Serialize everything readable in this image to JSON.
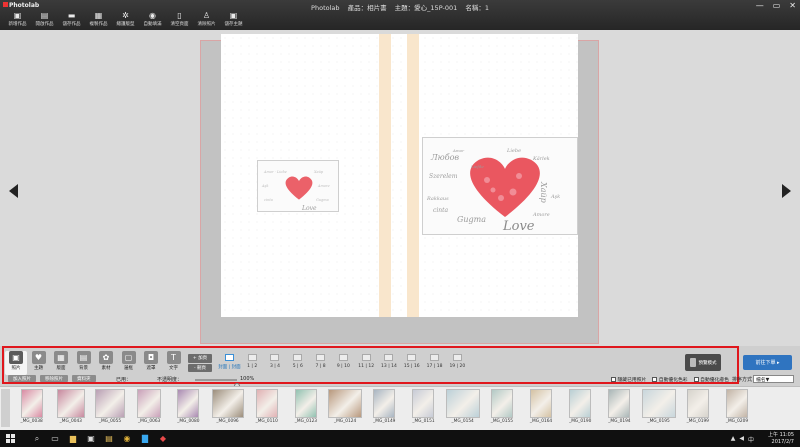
{
  "app": {
    "logo": "Photolab",
    "title": "Photolab",
    "product_label": "產品：相片書",
    "theme_label": "主題：愛心_15P-001",
    "name_label": "名稱：1"
  },
  "toolbar": {
    "items": [
      {
        "label": "新增作品",
        "icon": "new-file-icon"
      },
      {
        "label": "開啟作品",
        "icon": "open-folder-icon"
      },
      {
        "label": "儲存作品",
        "icon": "save-icon"
      },
      {
        "label": "複製作品",
        "icon": "copy-icon"
      },
      {
        "label": "總護版型",
        "icon": "sparkle-icon"
      },
      {
        "label": "自動填滿",
        "icon": "eye-icon"
      },
      {
        "label": "清空頁面",
        "icon": "clear-page-icon"
      },
      {
        "label": "清除照片",
        "icon": "clear-photo-icon"
      },
      {
        "label": "儲存主題",
        "icon": "save-theme-icon"
      }
    ]
  },
  "panel": {
    "tabs": [
      {
        "label": "照片",
        "icon": "photo-icon",
        "glyph": "▣",
        "active": true
      },
      {
        "label": "主題",
        "icon": "theme-icon",
        "glyph": "♥",
        "active": false
      },
      {
        "label": "版面",
        "icon": "layout-icon",
        "glyph": "▦",
        "active": false
      },
      {
        "label": "背景",
        "icon": "background-icon",
        "glyph": "▤",
        "active": false
      },
      {
        "label": "素材",
        "icon": "sticker-icon",
        "glyph": "✿",
        "active": false
      },
      {
        "label": "邊框",
        "icon": "frame-icon",
        "glyph": "▢",
        "active": false
      },
      {
        "label": "遮罩",
        "icon": "mask-icon",
        "glyph": "◘",
        "active": false
      },
      {
        "label": "文字",
        "icon": "text-icon",
        "glyph": "T",
        "active": false
      }
    ],
    "add_buttons": [
      "+ 加頁",
      "- 刪頁"
    ],
    "spreads": [
      "封面 | 封面",
      "1 | 2",
      "3 | 4",
      "5 | 6",
      "7 | 8",
      "9 | 10",
      "11 | 12",
      "13 | 14",
      "15 | 16",
      "17 | 18",
      "19 | 20"
    ],
    "active_spread": 0,
    "preview_label": "預覽模式",
    "order_label": "前往下單 ▸"
  },
  "controls": {
    "photo_tabs": [
      "加入照片",
      "移除照片",
      "資料夾"
    ],
    "used_label": "已用：",
    "opacity_label": "不透明度：",
    "opacity_value": "100%",
    "opacity_level": 1.0,
    "checkboxes": [
      "隱藏已用照片",
      "自動優化色彩",
      "自動優化膚色"
    ],
    "sort_label": "排序方式",
    "sort_value": "檔名▼"
  },
  "photos": [
    {
      "name": "_MG_0038",
      "w": 22,
      "color": "#d98aa3"
    },
    {
      "name": "_MG_0043",
      "w": 28,
      "color": "#c7889e"
    },
    {
      "name": "_MG_0055",
      "w": 30,
      "color": "#b99fb4"
    },
    {
      "name": "_MG_0063",
      "w": 24,
      "color": "#c9a0b9"
    },
    {
      "name": "_MG_0080",
      "w": 22,
      "color": "#a98ab2"
    },
    {
      "name": "_MG_0096",
      "w": 32,
      "color": "#9c8e7c"
    },
    {
      "name": "_MG_0110",
      "w": 22,
      "color": "#e0b1b4"
    },
    {
      "name": "_MG_0123",
      "w": 22,
      "color": "#92c2b1"
    },
    {
      "name": "_MG_0124",
      "w": 34,
      "color": "#b8987d"
    },
    {
      "name": "_MG_0149",
      "w": 22,
      "color": "#a8b5c2"
    },
    {
      "name": "_MG_0151",
      "w": 22,
      "color": "#c7cbd6"
    },
    {
      "name": "_MG_0154",
      "w": 34,
      "color": "#bcd0d8"
    },
    {
      "name": "_MG_0155",
      "w": 22,
      "color": "#b2c9c5"
    },
    {
      "name": "_MG_0164",
      "w": 22,
      "color": "#d4c2a3"
    },
    {
      "name": "_MG_0190",
      "w": 22,
      "color": "#b9cfd4"
    },
    {
      "name": "_MG_0194",
      "w": 22,
      "color": "#a9b6b7"
    },
    {
      "name": "_MG_0195",
      "w": 34,
      "color": "#c8d6dc"
    },
    {
      "name": "_MG_0199",
      "w": 22,
      "color": "#d6d3cc"
    },
    {
      "name": "_MG_0209",
      "w": 22,
      "color": "#c2b4a6"
    }
  ],
  "canvas": {
    "love_text": "Love",
    "words": [
      "Любов",
      "Liebe",
      "Amore",
      "Хайр",
      "Aşk",
      "Amor",
      "Szerelem",
      "Liefde",
      "Rakkaus",
      "cinta",
      "Gugma",
      "Kärlek"
    ]
  },
  "taskbar": {
    "search_icon": "search-icon",
    "time": "上午 11:05",
    "date": "2017/2/7"
  }
}
